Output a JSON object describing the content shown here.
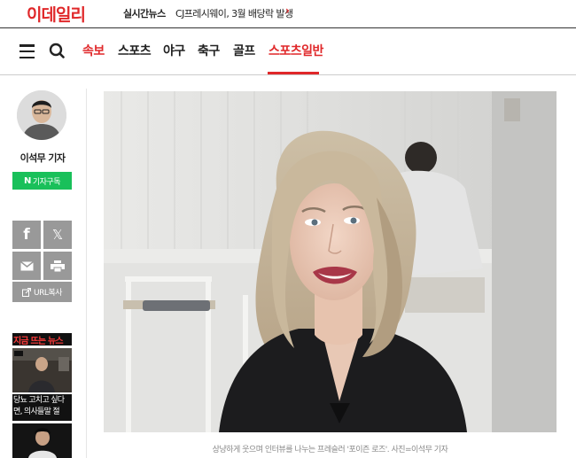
{
  "header": {
    "logo": "이데일리",
    "realtime_label": "실시간뉴스",
    "ticker_text": "CJ프레시웨이, 3월 배당락 발생",
    "ticker_arrow": "›"
  },
  "nav": {
    "items": [
      {
        "label": "속보"
      },
      {
        "label": "스포츠"
      },
      {
        "label": "야구"
      },
      {
        "label": "축구"
      },
      {
        "label": "골프"
      },
      {
        "label": "스포츠일반"
      }
    ],
    "active": "스포츠일반"
  },
  "reporter": {
    "name": "이석무 기자",
    "subscribe_label": "기자구독",
    "subscribe_n": "N"
  },
  "share": {
    "facebook": "f",
    "x": "𝕏",
    "url_copy": "URL복사"
  },
  "trending": {
    "title": "지금 뜨는 뉴스",
    "item1_text_line1": "당뇨 고치고 싶다",
    "item1_text_line2": "면, 의사들말 절"
  },
  "article": {
    "caption": "상냥하게 웃으며 인터뷰를 나누는 프레슬러 '포이즌 로즈'. 사진=이석무 기자"
  },
  "colors": {
    "brand_red": "#e0282a",
    "naver_green": "#19c05a",
    "share_gray": "#999999"
  }
}
